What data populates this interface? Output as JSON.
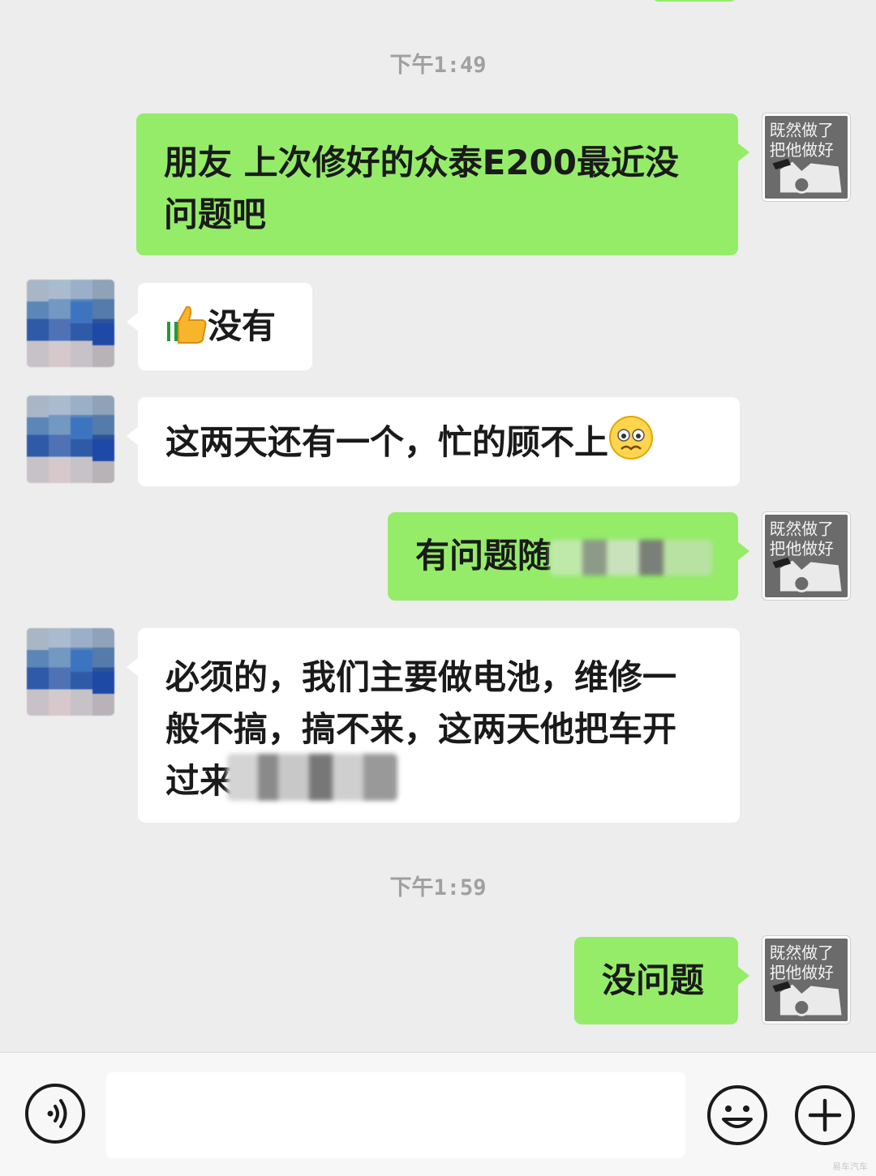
{
  "timestamps": [
    "下午1:49",
    "下午1:59"
  ],
  "messages": [
    {
      "side": "out",
      "lines": [
        "朋友  上次修好的众泰E200最近没",
        "问题吧"
      ]
    },
    {
      "side": "in",
      "text": "没有",
      "emoji": "thumbs-up"
    },
    {
      "side": "in",
      "text": "这两天还有一个，忙的顾不上",
      "emoji": "worried-face"
    },
    {
      "side": "out",
      "text": "有问题随"
    },
    {
      "side": "in",
      "lines": [
        "必须的，我们主要做电池，维修一",
        "般不搞，搞不来，这两天他把车开",
        "过来"
      ]
    },
    {
      "side": "out",
      "text": "没问题"
    }
  ],
  "my_avatar": {
    "caption_line1": "既然做了",
    "caption_line2": "把他做好"
  },
  "input": {
    "placeholder": ""
  },
  "icons": {
    "voice": "voice-icon",
    "emoji": "emoji-icon",
    "plus": "plus-icon"
  },
  "watermark": "易车汽车"
}
